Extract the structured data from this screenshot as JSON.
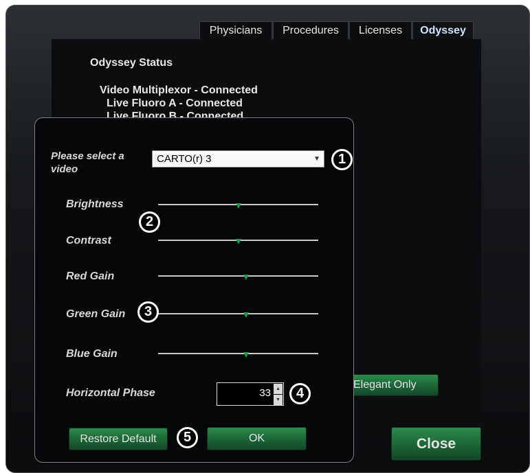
{
  "tabs": [
    "Physicians",
    "Procedures",
    "Licenses",
    "Odyssey"
  ],
  "status": {
    "heading": "Odyssey Status",
    "lines": [
      "Video Multiplexor - Connected",
      "Live Fluoro A - Connected",
      "Live Fluoro B - Connected"
    ]
  },
  "background_button": "Elegant Only",
  "close_label": "Close",
  "dialog": {
    "select_label": "Please select a video",
    "select_value": "CARTO(r) 3",
    "sliders": [
      {
        "label": "Brightness",
        "value": 0.5
      },
      {
        "label": "Contrast",
        "value": 0.5
      },
      {
        "label": "Red Gain",
        "value": 0.55
      },
      {
        "label": "Green Gain",
        "value": 0.55
      },
      {
        "label": "Blue Gain",
        "value": 0.55
      }
    ],
    "phase_label": "Horizontal Phase",
    "phase_value": "33",
    "restore_label": "Restore Default",
    "ok_label": "OK"
  },
  "callouts": [
    "1",
    "2",
    "3",
    "4",
    "5"
  ],
  "colors": {
    "accent_green": "#1e6b3a",
    "thumb": "#1f9a4a",
    "active_tab_text": "#cfe3ff"
  }
}
